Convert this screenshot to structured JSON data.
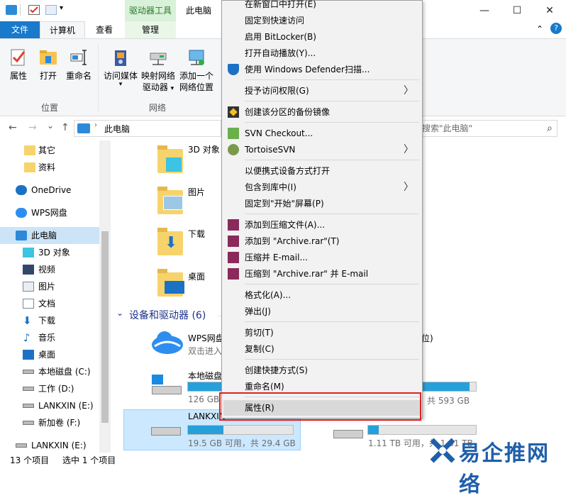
{
  "title_bar": {
    "context_tab_header": "驱动器工具",
    "window_title": "此电脑",
    "minimize_glyph": "—",
    "maximize_glyph": "☐",
    "close_glyph": "✕"
  },
  "ribbon_tabs": {
    "file": "文件",
    "computer": "计算机",
    "view": "查看",
    "manage": "管理"
  },
  "ribbon": {
    "properties": "属性",
    "open": "打开",
    "rename": "重命名",
    "access_media": "访问媒体",
    "map_drive_1": "映射网络",
    "map_drive_2": "驱动器",
    "add_location_1": "添加一个",
    "add_location_2": "网络位置",
    "group_location": "位置",
    "group_network": "网络",
    "dropdown_glyph": "▾"
  },
  "address": {
    "path": "此电脑",
    "search_placeholder": "搜索\"此电脑\"",
    "back": "←",
    "forward": "→",
    "history": "⌄",
    "up": "↑",
    "search_glyph": "⌕"
  },
  "sidebar": {
    "items": [
      {
        "label": "其它"
      },
      {
        "label": "资料"
      },
      {
        "label": "OneDrive"
      },
      {
        "label": "WPS网盘"
      },
      {
        "label": "此电脑"
      },
      {
        "label": "3D 对象"
      },
      {
        "label": "视频"
      },
      {
        "label": "图片"
      },
      {
        "label": "文档"
      },
      {
        "label": "下载"
      },
      {
        "label": "音乐"
      },
      {
        "label": "桌面"
      },
      {
        "label": "本地磁盘 (C:)"
      },
      {
        "label": "工作 (D:)"
      },
      {
        "label": "LANKXIN (E:)"
      },
      {
        "label": "新加卷 (F:)"
      },
      {
        "label": "LANKXIN (E:)"
      }
    ]
  },
  "main": {
    "folders": {
      "objects_3d": "3D 对象",
      "pictures": "图片",
      "downloads": "下载",
      "desktop": "桌面"
    },
    "section_header": "设备和驱动器 (6)",
    "section_chevron": "⌄",
    "drives": {
      "wps_name": "WPS网盘",
      "wps_sub": "双击进入",
      "c_name": "本地磁盘",
      "c_free": "126 GB",
      "e_name": "LANKXIN",
      "e_free": "19.5 GB 可用，共 29.4 GB",
      "right_sub1": "位)",
      "right_total1": "共 593 GB",
      "right_free2": "1.11 TB 可用，共 1.81 TB"
    }
  },
  "status": {
    "count": "13 个项目",
    "selected": "选中 1 个项目"
  },
  "context_menu": {
    "items": {
      "open_new": "在新窗口中打开(E)",
      "pin_quick": "固定到快速访问",
      "bitlocker": "启用 BitLocker(B)",
      "autoplay": "打开自动播放(Y)...",
      "defender": "使用 Windows Defender扫描...",
      "grant_access": "授予访问权限(G)",
      "backup_image": "创建该分区的备份镜像",
      "svn_checkout": "SVN Checkout...",
      "tortoise": "TortoiseSVN",
      "portable": "以便携式设备方式打开",
      "include_lib": "包含到库中(I)",
      "pin_start": "固定到\"开始\"屏幕(P)",
      "add_archive": "添加到压缩文件(A)...",
      "add_archive_rar": "添加到 \"Archive.rar\"(T)",
      "compress_email": "压缩并 E-mail...",
      "compress_rar_email": "压缩到 \"Archive.rar\" 并 E-mail",
      "format": "格式化(A)...",
      "eject": "弹出(J)",
      "cut": "剪切(T)",
      "copy": "复制(C)",
      "shortcut": "创建快捷方式(S)",
      "rename": "重命名(M)",
      "properties": "属性(R)"
    },
    "submenu_arrow": "〉"
  },
  "watermark": {
    "text": "易企推网络"
  },
  "colors": {
    "accent": "#1979ca",
    "highlight_box": "#e02020",
    "drive_bar": "#26a0da"
  },
  "drive_usage": {
    "c": 0.55,
    "e": 0.34,
    "right1": 0.88,
    "right2": 0.1
  }
}
